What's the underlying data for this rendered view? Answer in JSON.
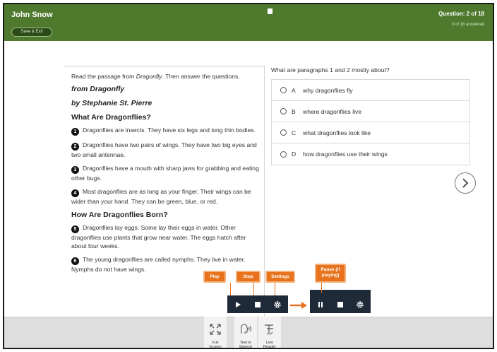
{
  "header": {
    "student_name": "John Snow",
    "save_exit": "Save & Exit",
    "question_counter": "Question: 2 of 18",
    "answered": "0 of 18 answered"
  },
  "passage": {
    "intro_pre": "Read the passage from ",
    "intro_title": "Dragonfly",
    "intro_post": ". Then answer the questions.",
    "source_title": "from Dragonfly",
    "author": "by Stephanie St. Pierre",
    "heading1": "What Are Dragonflies?",
    "heading2": "How Are Dragonflies Born?",
    "paragraphs": [
      {
        "num": "1",
        "text": "Dragonflies are insects. They have six legs and long thin bodies."
      },
      {
        "num": "2",
        "text": "Dragonflies have two pairs of wings. They have two big eyes and two small antennae."
      },
      {
        "num": "3",
        "text": "Dragonflies have a mouth with sharp jaws for grabbing and eating other bugs."
      },
      {
        "num": "4",
        "text": "Most dragonflies are as long as your finger. Their wings can be wider than your hand. They can be green, blue, or red."
      },
      {
        "num": "5",
        "text": "Dragonflies lay eggs. Some lay their eggs in water. Other dragonflies use plants that grow near water. The eggs hatch after about four weeks."
      },
      {
        "num": "6",
        "text": "The young dragonflies are called nymphs. They live in water. Nymphs do not have wings."
      }
    ]
  },
  "question": {
    "stem": "What are paragraphs 1 and 2 mostly about?",
    "choices": [
      {
        "letter": "A",
        "text": "why dragonflies fly"
      },
      {
        "letter": "B",
        "text": "where dragonflies live"
      },
      {
        "letter": "C",
        "text": "what dragonflies look like"
      },
      {
        "letter": "D",
        "text": "how dragonflies use their wings"
      }
    ]
  },
  "toolbar": {
    "full_screen_1": "Full",
    "full_screen_2": "Screen",
    "tts_1": "Text to",
    "tts_2": "Speech",
    "line_reader_1": "Line",
    "line_reader_2": "Reader"
  },
  "callouts": {
    "play": "Play",
    "stop": "Stop",
    "settings": "Settings",
    "pause_1": "Pause (if",
    "pause_2": "playing)"
  },
  "colors": {
    "header_green": "#4f7a2e",
    "callout_orange": "#e8731c",
    "player_navy": "#1f2a38"
  }
}
